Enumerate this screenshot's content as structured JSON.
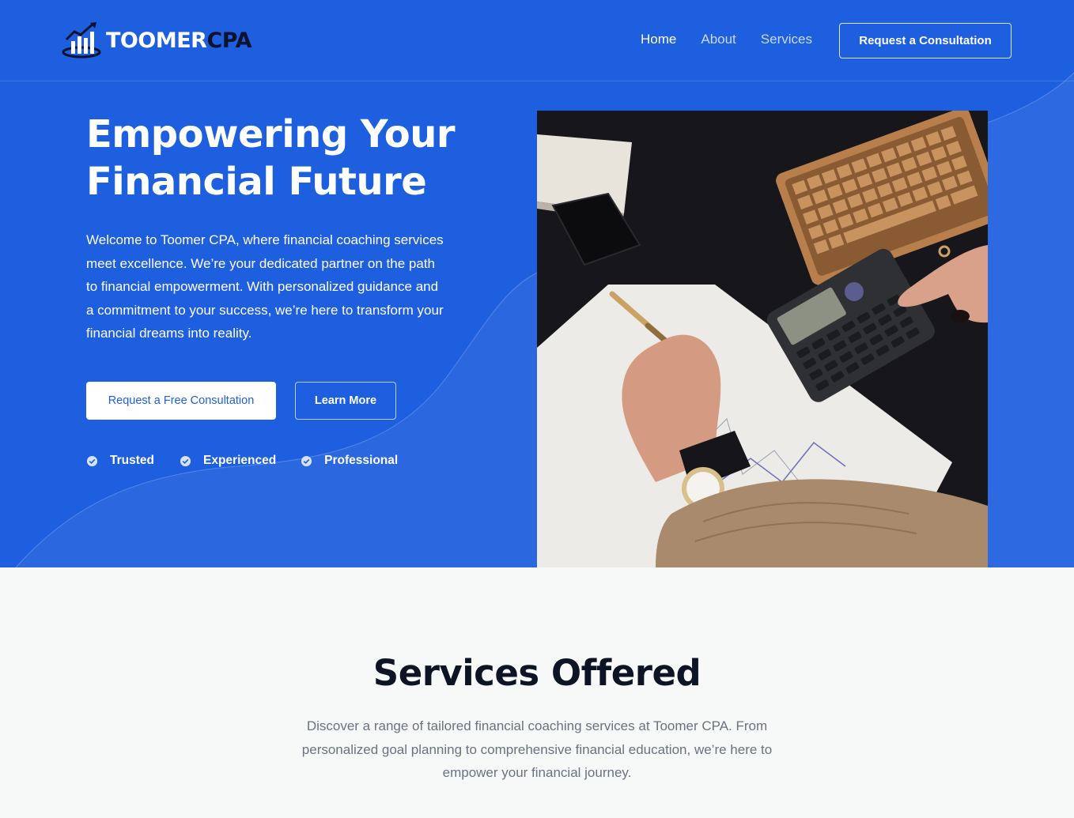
{
  "header": {
    "logo": {
      "part1": "TOOMER",
      "part2": "CPA"
    },
    "nav": [
      {
        "label": "Home",
        "active": true
      },
      {
        "label": "About",
        "active": false
      },
      {
        "label": "Services",
        "active": false
      }
    ],
    "cta_label": "Request a Consultation"
  },
  "hero": {
    "title_line1": "Empowering Your",
    "title_line2": "Financial Future",
    "description": "Welcome to Toomer CPA, where financial coaching services meet excellence. We’re your dedicated partner on the path to financial empowerment. With personalized guidance and a commitment to your success, we’re here to transform your financial dreams into reality.",
    "primary_button": "Request a Free Consultation",
    "secondary_button": "Learn More",
    "badges": [
      "Trusted",
      "Experienced",
      "Professional"
    ]
  },
  "services": {
    "title": "Services Offered",
    "description": "Discover a range of tailored financial coaching services at Toomer CPA. From personalized goal planning to comprehensive financial education, we’re here to empower your financial journey."
  },
  "colors": {
    "brand_blue": "#1e5fdf",
    "dark": "#0d1525",
    "muted_text": "#6b7280",
    "section_bg": "#f7f8f8"
  }
}
